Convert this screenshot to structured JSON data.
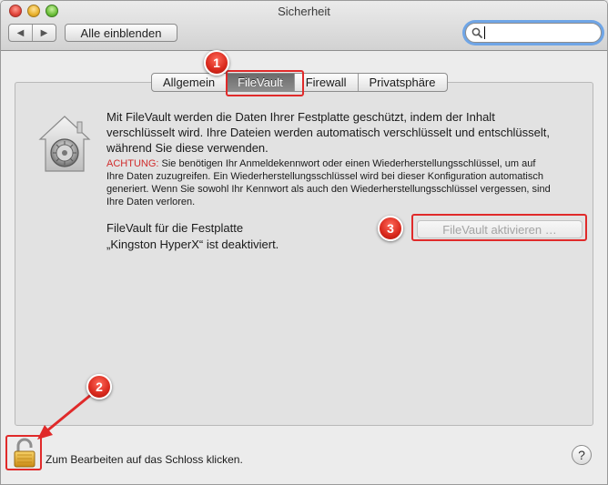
{
  "window": {
    "title": "Sicherheit"
  },
  "toolbar": {
    "back_glyph": "◀",
    "forward_glyph": "▶",
    "show_all_label": "Alle einblenden",
    "search": {
      "value": "",
      "placeholder": ""
    }
  },
  "tabs": [
    {
      "label": "Allgemein",
      "active": false
    },
    {
      "label": "FileVault",
      "active": true
    },
    {
      "label": "Firewall",
      "active": false
    },
    {
      "label": "Privatsphäre",
      "active": false
    }
  ],
  "filevault": {
    "description": "Mit FileVault werden die Daten Ihrer Festplatte geschützt, indem der Inhalt verschlüsselt wird. Ihre Dateien werden automatisch verschlüsselt und entschlüsselt, während Sie diese verwenden.",
    "warning_label": "ACHTUNG:",
    "warning_text": " Sie benötigen Ihr Anmeldekennwort oder einen Wiederherstellungsschlüssel, um auf Ihre Daten zuzugreifen. Ein Wiederherstellungsschlüssel wird bei dieser Konfiguration automatisch generiert. Wenn Sie sowohl Ihr Kennwort als auch den Wiederherstellungsschlüssel vergessen, sind Ihre Daten verloren.",
    "status_line1": "FileVault für die Festplatte",
    "status_line2": "„Kingston HyperX“ ist deaktiviert.",
    "activate_button": "FileVault aktivieren …"
  },
  "footer": {
    "lock_text": "Zum Bearbeiten auf das Schloss klicken.",
    "help_label": "?"
  },
  "annotations": {
    "badge1": "1",
    "badge2": "2",
    "badge3": "3",
    "color": "#e02a2a"
  },
  "icons": {
    "house": "filevault-house-icon",
    "lock": "padlock-open-icon",
    "search": "magnifier-icon"
  }
}
